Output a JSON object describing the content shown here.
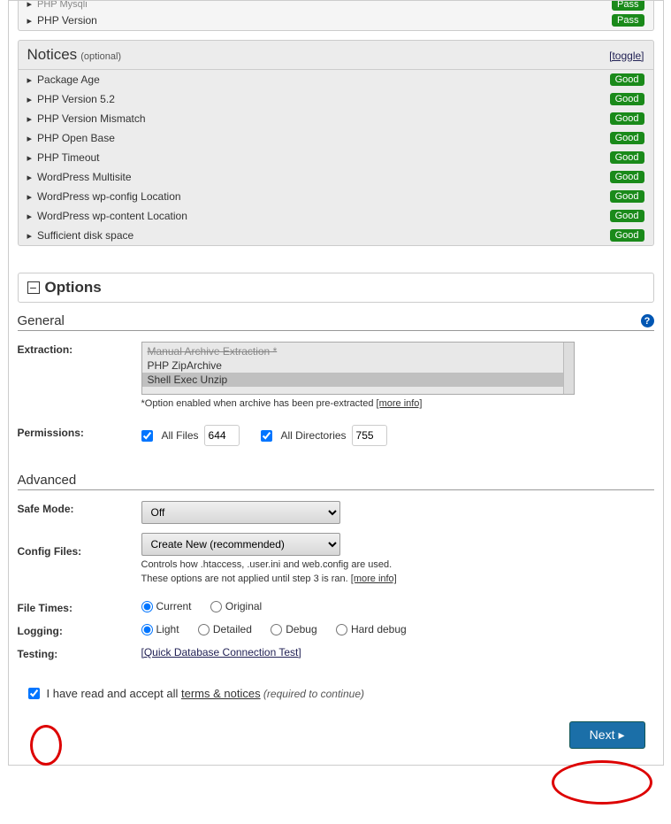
{
  "top_checks": [
    {
      "label": "PHP Mysqli",
      "status": "Pass"
    },
    {
      "label": "PHP Version",
      "status": "Pass"
    }
  ],
  "notices": {
    "title": "Notices",
    "subtitle": "(optional)",
    "toggle": "[toggle]",
    "items": [
      {
        "label": "Package Age",
        "status": "Good"
      },
      {
        "label": "PHP Version 5.2",
        "status": "Good"
      },
      {
        "label": "PHP Version Mismatch",
        "status": "Good"
      },
      {
        "label": "PHP Open Base",
        "status": "Good"
      },
      {
        "label": "PHP Timeout",
        "status": "Good"
      },
      {
        "label": "WordPress Multisite",
        "status": "Good"
      },
      {
        "label": "WordPress wp-config Location",
        "status": "Good"
      },
      {
        "label": "WordPress wp-content Location",
        "status": "Good"
      },
      {
        "label": "Sufficient disk space",
        "status": "Good"
      }
    ]
  },
  "options_title": "Options",
  "general": {
    "title": "General",
    "extraction_label": "Extraction:",
    "extraction_options": {
      "disabled": "Manual Archive Extraction *",
      "opt1": "PHP ZipArchive",
      "opt2": "Shell Exec Unzip"
    },
    "extraction_hint": "*Option enabled when archive has been pre-extracted ",
    "more_info": "[more info]",
    "permissions_label": "Permissions:",
    "perm_files": "All Files",
    "perm_files_val": "644",
    "perm_dirs": "All Directories",
    "perm_dirs_val": "755"
  },
  "advanced": {
    "title": "Advanced",
    "safe_mode_label": "Safe Mode:",
    "safe_mode_value": "Off",
    "config_label": "Config Files:",
    "config_value": "Create New (recommended)",
    "config_hint1": "Controls how .htaccess, .user.ini and web.config are used.",
    "config_hint2": "These options are not applied until step 3 is ran. ",
    "more_info": "[more info]",
    "file_times_label": "File Times:",
    "file_times": {
      "current": "Current",
      "original": "Original"
    },
    "logging_label": "Logging:",
    "logging": {
      "light": "Light",
      "detailed": "Detailed",
      "debug": "Debug",
      "hard": "Hard debug"
    },
    "testing_label": "Testing:",
    "testing_link": "[Quick Database Connection Test]"
  },
  "terms": {
    "prefix": "I have read and accept all ",
    "link": "terms & notices",
    "suffix": " (required to continue)"
  },
  "next_button": "Next"
}
